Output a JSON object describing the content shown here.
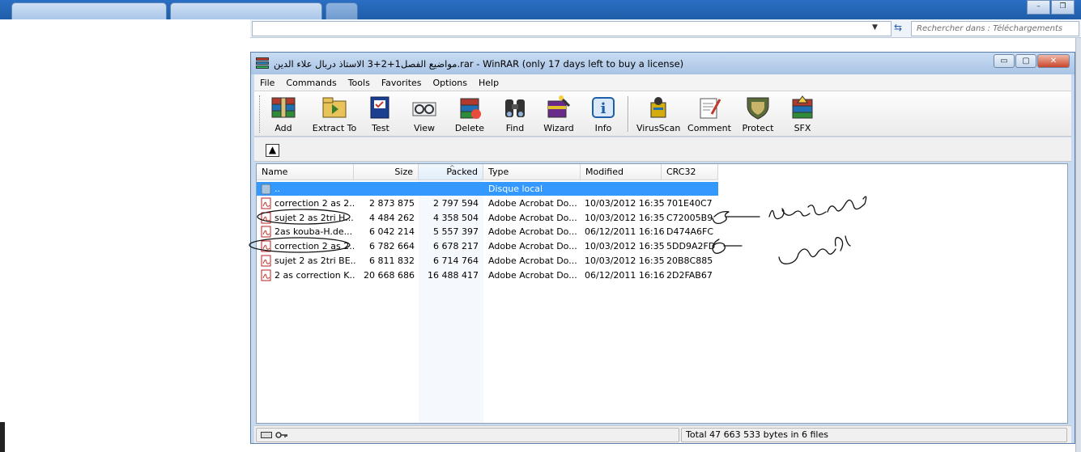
{
  "browser": {
    "search_placeholder": "Rechercher dans : Téléchargements"
  },
  "window": {
    "title": "مواضيع الفصل1+2+3 الاستاذ دربال علاء الدين.rar - WinRAR (only 17 days left to buy a license)",
    "min_glyph": "▭",
    "max_glyph": "▢",
    "close_glyph": "✕"
  },
  "menu": [
    "File",
    "Commands",
    "Tools",
    "Favorites",
    "Options",
    "Help"
  ],
  "toolbar": [
    {
      "label": "Add",
      "icon": "add-icon"
    },
    {
      "label": "Extract To",
      "icon": "extract-to-icon"
    },
    {
      "label": "Test",
      "icon": "test-icon"
    },
    {
      "label": "View",
      "icon": "view-icon"
    },
    {
      "label": "Delete",
      "icon": "delete-icon"
    },
    {
      "label": "Find",
      "icon": "find-icon"
    },
    {
      "label": "Wizard",
      "icon": "wizard-icon"
    },
    {
      "label": "Info",
      "icon": "info-icon"
    },
    {
      "label": "VirusScan",
      "icon": "virus-scan-icon"
    },
    {
      "label": "Comment",
      "icon": "comment-icon"
    },
    {
      "label": "Protect",
      "icon": "protect-icon"
    },
    {
      "label": "SFX",
      "icon": "sfx-icon"
    }
  ],
  "columns": [
    "Name",
    "Size",
    "Packed",
    "Type",
    "Modified",
    "CRC32"
  ],
  "parent_row": {
    "name": "..",
    "type": "Disque local"
  },
  "files": [
    {
      "name": "correction 2 as 2...",
      "size": "2 873 875",
      "packed": "2 797 594",
      "type": "Adobe Acrobat Do...",
      "modified": "10/03/2012 16:35",
      "crc": "701E40C7"
    },
    {
      "name": "sujet 2 as 2tri H...",
      "size": "4 484 262",
      "packed": "4 358 504",
      "type": "Adobe Acrobat Do...",
      "modified": "10/03/2012 16:35",
      "crc": "C72005B9"
    },
    {
      "name": "2as kouba-H.de...",
      "size": "6 042 214",
      "packed": "5 557 397",
      "type": "Adobe Acrobat Do...",
      "modified": "06/12/2011 16:16",
      "crc": "D474A6FC"
    },
    {
      "name": "correction 2 as 2...",
      "size": "6 782 664",
      "packed": "6 678 217",
      "type": "Adobe Acrobat Do...",
      "modified": "10/03/2012 16:35",
      "crc": "5DD9A2FD"
    },
    {
      "name": "sujet 2 as 2tri BE...",
      "size": "6 811 832",
      "packed": "6 714 764",
      "type": "Adobe Acrobat Do...",
      "modified": "10/03/2012 16:35",
      "crc": "20B8C885"
    },
    {
      "name": "2 as correction K...",
      "size": "20 668 686",
      "packed": "16 488 417",
      "type": "Adobe Acrobat Do...",
      "modified": "06/12/2011 16:16",
      "crc": "2D2FAB67"
    }
  ],
  "status": {
    "summary": "Total 47 663 533 bytes in 6 files"
  }
}
